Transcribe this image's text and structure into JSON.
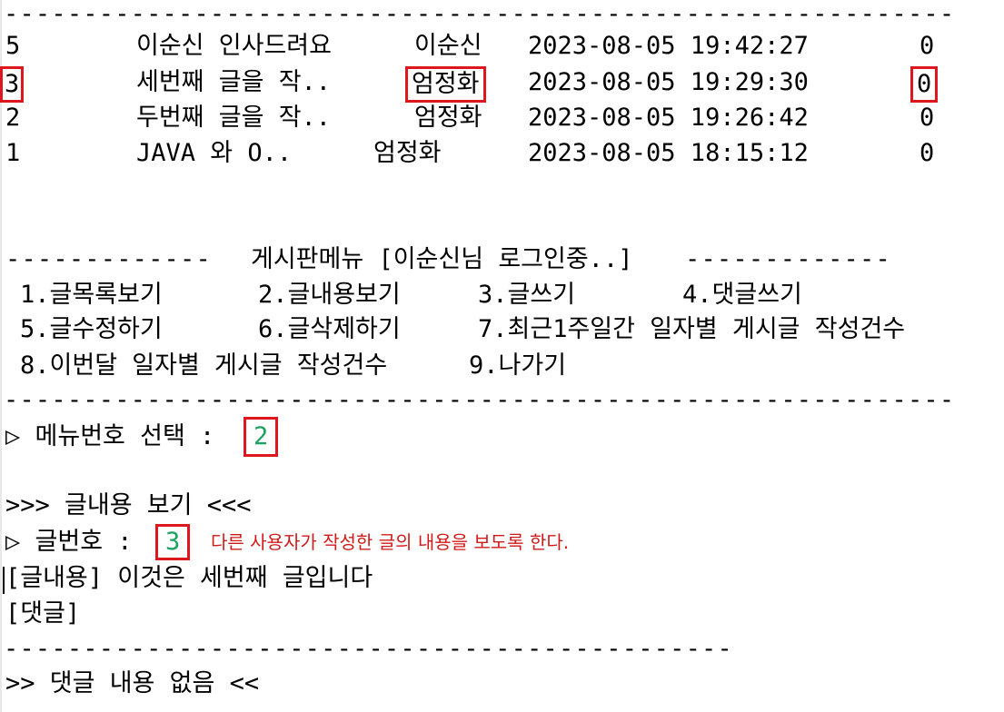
{
  "separators": {
    "full": "------------------------------------------------------------",
    "short": "----------------------------------------------"
  },
  "posts": [
    {
      "num": "5",
      "title": "이순신 인사드려요",
      "author": "이순신",
      "date": "2023-08-05 19:42:27",
      "count": "0"
    },
    {
      "num": "3",
      "title": "세번째 글을 작..",
      "author": "엄정화",
      "date": "2023-08-05 19:29:30",
      "count": "0"
    },
    {
      "num": "2",
      "title": "두번째 글을 작..",
      "author": "엄정화",
      "date": "2023-08-05 19:26:42",
      "count": "0"
    },
    {
      "num": "1",
      "title": "JAVA 와 O..",
      "author": "엄정화",
      "date": "2023-08-05 18:15:12",
      "count": "0"
    }
  ],
  "menu": {
    "header_dashes": "-------------",
    "title": "게시판메뉴 [이순신님 로그인중..]",
    "items": [
      "1.글목록보기",
      "2.글내용보기",
      "3.글쓰기",
      "4.댓글쓰기",
      "5.글수정하기",
      "6.글삭제하기",
      "7.최근1주일간 일자별 게시글 작성건수",
      "8.이번달 일자별 게시글 작성건수",
      "9.나가기"
    ]
  },
  "prompt": {
    "menu_select_label": "▷ 메뉴번호 선택 :",
    "menu_select_value": "2",
    "view_title": ">>> 글내용 보기 <<<",
    "post_num_label": "▷ 글번호 :",
    "post_num_value": "3",
    "note": "다른 사용자가 작성한 글의 내용을 보도록 한다."
  },
  "content": {
    "body_line": "[글내용] 이것은 세번째 글입니다",
    "comment_label": "[댓글]",
    "no_comment": ">> 댓글 내용 없음 <<"
  }
}
